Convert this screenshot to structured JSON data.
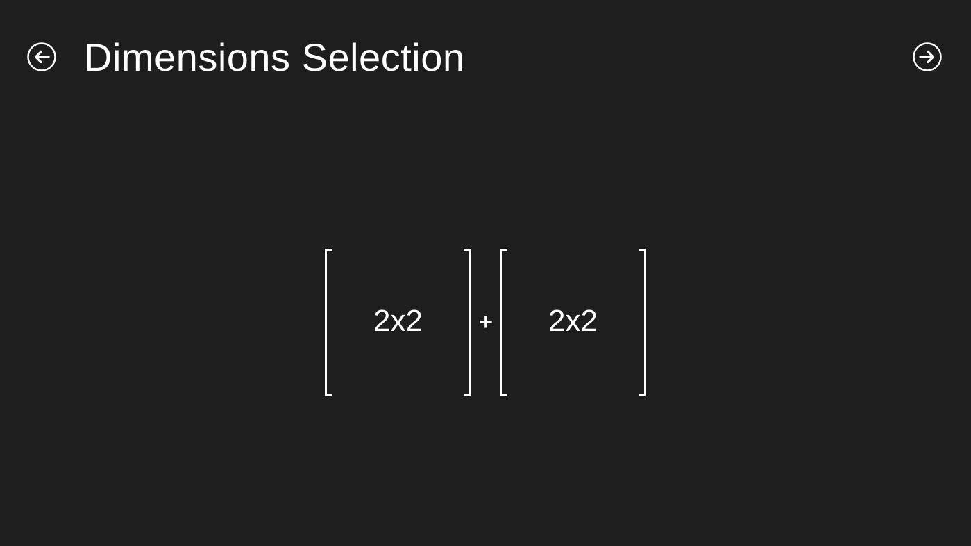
{
  "header": {
    "title": "Dimensions Selection",
    "back_icon": "arrow-left-circle-icon",
    "forward_icon": "arrow-right-circle-icon"
  },
  "matrices": [
    {
      "dimensions": "2x2"
    },
    {
      "dimensions": "2x2"
    }
  ],
  "operator": "+",
  "colors": {
    "background": "#1e1e1e",
    "foreground": "#ffffff"
  }
}
